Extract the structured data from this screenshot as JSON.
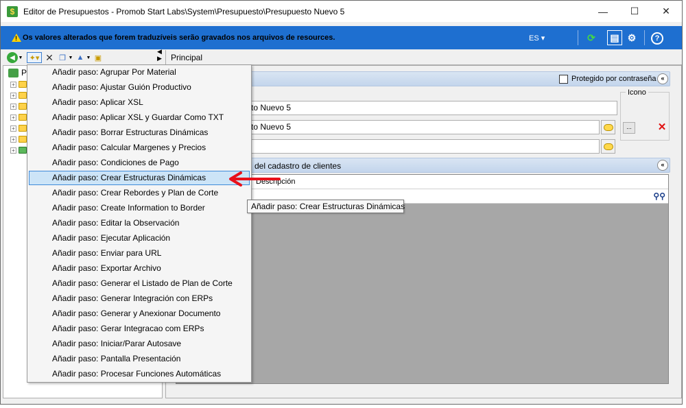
{
  "window": {
    "title": "Editor de Presupuestos - Promob Start Labs\\System\\Presupuesto\\Presupuesto Nuevo 5",
    "minimize": "—",
    "maximize": "☐",
    "close": "✕"
  },
  "infobar": {
    "message": "Os valores alterados que forem traduzíveis serão gravados nos arquivos de resources.",
    "language": "ES ▾",
    "refresh_icon": "⟳",
    "layout_icon": "▤",
    "settings_icon": "⚙",
    "help_icon": "?"
  },
  "tabs": {
    "active": "Principal"
  },
  "tree": {
    "root_label": "P"
  },
  "main": {
    "protected_label": "Protegido por contraseña",
    "icono_label": "Icono",
    "field1": "to Nuevo 5",
    "field2": "to Nuevo 5",
    "field3": "",
    "browse_btn": "...",
    "remove_btn": "✕",
    "collapse": "«",
    "group2_title": "del cadastro de clientes",
    "grid_column": "Descripción",
    "binoculars": "👓"
  },
  "menu": {
    "items": [
      "Añadir paso: Agrupar Por Material",
      "Añadir paso: Ajustar Guión Productivo",
      "Añadir paso: Aplicar XSL",
      "Añadir paso: Aplicar XSL y Guardar Como TXT",
      "Añadir paso: Borrar Estructuras Dinámicas",
      "Añadir paso: Calcular Margenes y Precios",
      "Añadir paso: Condiciones de Pago",
      "Añadir paso: Crear Estructuras Dinámicas",
      "Añadir paso: Crear Rebordes y Plan de Corte",
      "Añadir paso: Create Information to Border",
      "Añadir paso: Editar la Observación",
      "Añadir paso: Ejecutar Aplicación",
      "Añadir paso: Enviar para URL",
      "Añadir paso: Exportar Archivo",
      "Añadir paso: Generar el Listado de Plan de Corte",
      "Añadir paso: Generar Integración con ERPs",
      "Añadir paso: Generar y Anexionar Documento",
      "Añadir paso: Gerar Integracao com ERPs",
      "Añadir paso: Iniciar/Parar Autosave",
      "Añadir paso: Pantalla Presentación",
      "Añadir paso: Procesar Funciones Automáticas"
    ],
    "highlighted_index": 7
  },
  "tooltip": "Añadir paso: Crear Estructuras Dinámicas",
  "colors": {
    "infobar": "#1e6fd0",
    "highlight": "#cce4f7",
    "highlight_border": "#3e8ad8",
    "arrow": "#e8101a"
  }
}
